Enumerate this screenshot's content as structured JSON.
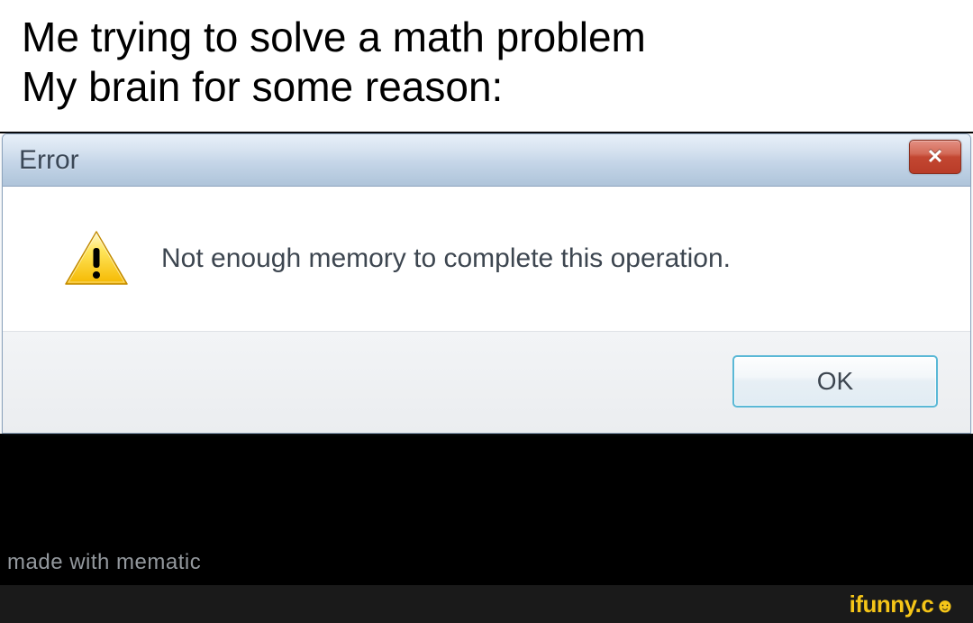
{
  "caption": {
    "line1": "Me trying to solve a math problem",
    "line2": "My brain for some reason:"
  },
  "dialog": {
    "title": "Error",
    "close_symbol": "✕",
    "message": "Not enough memory to complete this operation.",
    "ok_label": "OK"
  },
  "watermarks": {
    "mematic": "made with mematic",
    "ifunny_text": "ifunny.c",
    "ifunny_smile": "☻"
  }
}
